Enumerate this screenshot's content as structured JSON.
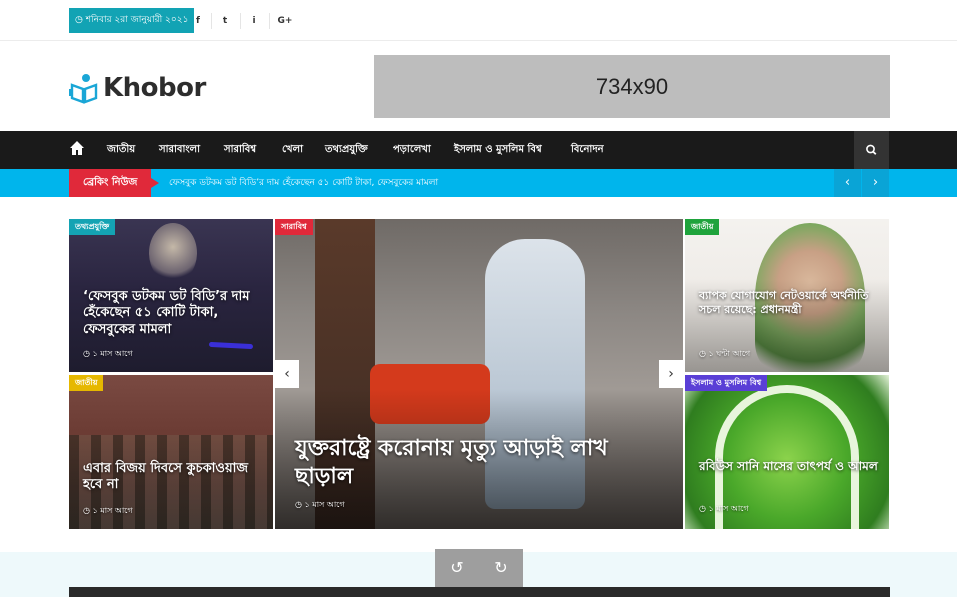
{
  "topbar": {
    "date": "শনিবার ২রা জানুয়ারী ২০২১",
    "social": [
      "f",
      "t",
      "i",
      "G+"
    ]
  },
  "header": {
    "logo_text": "Khobor",
    "ad_label": "734x90"
  },
  "nav": {
    "items": [
      "জাতীয়",
      "সারাবাংলা",
      "সারাবিশ্ব",
      "খেলা",
      "তথ্যপ্রযুক্তি",
      "পড়ালেখা",
      "ইসলাম ও মুসলিম বিশ্ব",
      "বিনোদন"
    ]
  },
  "breaking": {
    "label": "ব্রেকিং নিউজ",
    "text": "ফেসবুক ডটকম ডট বিডি’র দাম হেঁকেছেন ৫১ কোটি টাকা, ফেসবুকের মামলা",
    "prev": "‹",
    "next": "›"
  },
  "cards": {
    "c1": {
      "category": "তথ্যপ্রযুক্তি",
      "title": "‘ফেসবুক ডটকম ডট বিডি’র দাম হেঁকেছেন ৫১ কোটি টাকা, ফেসবুকের মামলা",
      "time": "১ মাস আগে"
    },
    "c2": {
      "category": "জাতীয়",
      "title": "এবার বিজয় দিবসে কুচকাওয়াজ হবে না",
      "time": "১ মাস আগে"
    },
    "main": {
      "category": "সারাবিশ্ব",
      "title": "যুক্তরাষ্ট্রে করোনায় মৃত্যু আড়াই লাখ ছাড়াল",
      "time": "১ মাস আগে"
    },
    "c3": {
      "category": "জাতীয়",
      "title": "ব্যাপক যোগাযোগ নেটওয়ার্কে অর্থনীতি সচল রয়েছে: প্রধানমন্ত্রী",
      "time": "১ ঘন্টা আগে"
    },
    "c4": {
      "category": "ইসলাম ও মুসলিম বিশ্ব",
      "title": "রবিউস সানি মাসের তাৎপর্য ও আমল",
      "time": "১ মাস আগে"
    }
  },
  "colors": {
    "date_badge": "#12a3b4",
    "breaking_bar": "#00b5ec",
    "breaking_label": "#e0293a",
    "nav_bg": "#1a1a1a",
    "cat_tech": "#14a3b3",
    "cat_world": "#e0293a",
    "cat_national": "#1fa33c",
    "cat_national_yellow": "#e6b800",
    "cat_islam": "#5a3fd6"
  },
  "icons": [
    "clock-icon",
    "facebook-icon",
    "twitter-icon",
    "dribbble-icon",
    "google-plus-icon",
    "home-icon",
    "search-icon",
    "chevron-left-icon",
    "chevron-right-icon",
    "rotate-left-icon",
    "rotate-right-icon"
  ]
}
